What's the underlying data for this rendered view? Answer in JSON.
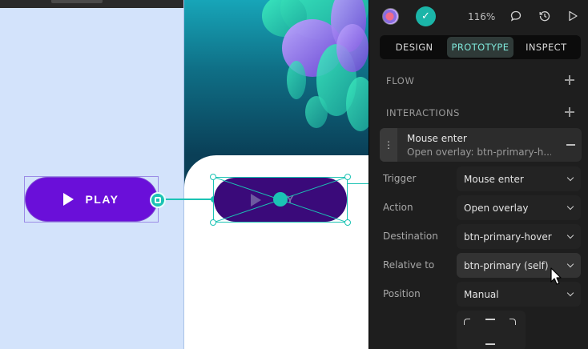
{
  "canvas": {
    "play_button": {
      "label": "PLAY"
    },
    "hover_button": {
      "label": "AY"
    }
  },
  "topbar": {
    "zoom": "116%",
    "icons": [
      "avatar",
      "check-icon",
      "comment-icon",
      "history-icon",
      "play-icon"
    ]
  },
  "tabs": [
    {
      "label": "DESIGN",
      "active": false
    },
    {
      "label": "PROTOTYPE",
      "active": true
    },
    {
      "label": "INSPECT",
      "active": false
    }
  ],
  "sections": {
    "flow": "FLOW",
    "interactions": "INTERACTIONS"
  },
  "interaction": {
    "title": "Mouse enter",
    "subtitle": "Open overlay: btn-primary-h..."
  },
  "fields": {
    "trigger": {
      "label": "Trigger",
      "value": "Mouse enter"
    },
    "action": {
      "label": "Action",
      "value": "Open overlay"
    },
    "destination": {
      "label": "Destination",
      "value": "btn-primary-hover"
    },
    "relative_to": {
      "label": "Relative to",
      "value": "btn-primary (self)"
    },
    "position": {
      "label": "Position",
      "value": "Manual"
    }
  },
  "colors": {
    "accent": "#1bc3b4",
    "primary_button": "#6a0fd9",
    "panel_bg": "#1e1e1e"
  }
}
